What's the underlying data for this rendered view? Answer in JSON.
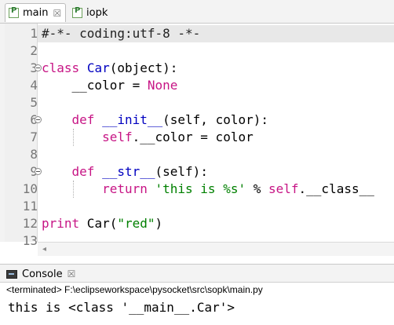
{
  "tabs": [
    {
      "label": "main",
      "active": true,
      "icon": "python-file-icon"
    },
    {
      "label": "iopk",
      "active": false,
      "icon": "python-file-icon"
    }
  ],
  "tab_close_glyph": "☒",
  "editor": {
    "lines": [
      {
        "num": "1"
      },
      {
        "num": "2"
      },
      {
        "num": "3"
      },
      {
        "num": "4"
      },
      {
        "num": "5"
      },
      {
        "num": "6"
      },
      {
        "num": "7"
      },
      {
        "num": "8"
      },
      {
        "num": "9"
      },
      {
        "num": "10"
      },
      {
        "num": "11"
      },
      {
        "num": "12"
      },
      {
        "num": "13"
      }
    ],
    "tokens": {
      "l1": "#-*- coding:utf-8 -*-",
      "l3_kw": "class",
      "l3_cls": "Car",
      "l3_rest": "(object):",
      "l4_a": "    __color = ",
      "l4_b": "None",
      "l6_kw": "def",
      "l6_fn": "__init__",
      "l6_rest": "(self, color):",
      "l7_a": "self",
      "l7_b": ".__color = color",
      "l9_kw": "def",
      "l9_fn": "__str__",
      "l9_rest": "(self):",
      "l10_kw": "return",
      "l10_str": "'this is %s'",
      "l10_op": " % ",
      "l10_self": "self",
      "l10_rest": ".__class__",
      "l12_kw": "print",
      "l12_a": " Car(",
      "l12_str": "\"red\"",
      "l12_b": ")"
    }
  },
  "console": {
    "tab_label": "Console",
    "status": "<terminated> F:\\eclipseworkspace\\pysocket\\src\\sopk\\main.py",
    "output": "this is <class '__main__.Car'>"
  },
  "colors": {
    "keyword": "#c71585",
    "class_name": "#0000c0",
    "string": "#008000",
    "current_line": "#e8e8e8"
  }
}
